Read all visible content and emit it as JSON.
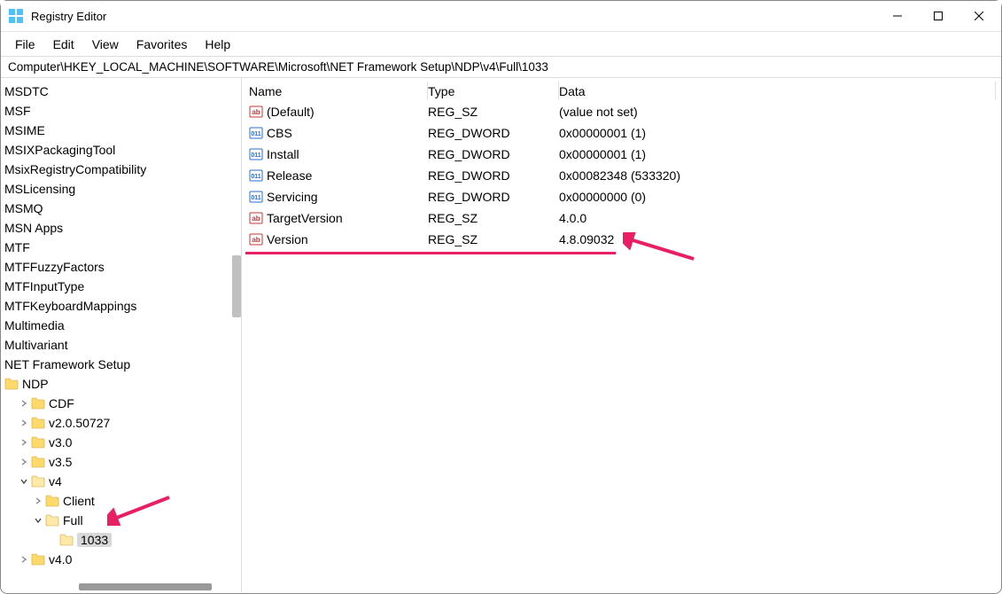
{
  "window": {
    "title": "Registry Editor"
  },
  "menu": [
    "File",
    "Edit",
    "View",
    "Favorites",
    "Help"
  ],
  "address": "Computer\\HKEY_LOCAL_MACHINE\\SOFTWARE\\Microsoft\\NET Framework Setup\\NDP\\v4\\Full\\1033",
  "tree": {
    "items": [
      {
        "label": "MSDTC",
        "lvl": 1
      },
      {
        "label": "MSF",
        "lvl": 1
      },
      {
        "label": "MSIME",
        "lvl": 1
      },
      {
        "label": "MSIXPackagingTool",
        "lvl": 1
      },
      {
        "label": "MsixRegistryCompatibility",
        "lvl": 1
      },
      {
        "label": "MSLicensing",
        "lvl": 1
      },
      {
        "label": "MSMQ",
        "lvl": 1
      },
      {
        "label": "MSN Apps",
        "lvl": 1
      },
      {
        "label": "MTF",
        "lvl": 1
      },
      {
        "label": "MTFFuzzyFactors",
        "lvl": 1
      },
      {
        "label": "MTFInputType",
        "lvl": 1
      },
      {
        "label": "MTFKeyboardMappings",
        "lvl": 1
      },
      {
        "label": "Multimedia",
        "lvl": 1
      },
      {
        "label": "Multivariant",
        "lvl": 1
      },
      {
        "label": "NET Framework Setup",
        "lvl": 1
      },
      {
        "label": "NDP",
        "lvl": 1,
        "folder": true
      },
      {
        "label": "CDF",
        "lvl": 2,
        "folder": true,
        "chev": "right"
      },
      {
        "label": "v2.0.50727",
        "lvl": 2,
        "folder": true,
        "chev": "right"
      },
      {
        "label": "v3.0",
        "lvl": 2,
        "folder": true,
        "chev": "right"
      },
      {
        "label": "v3.5",
        "lvl": 2,
        "folder": true,
        "chev": "right"
      },
      {
        "label": "v4",
        "lvl": 2,
        "folder": true,
        "chev": "down"
      },
      {
        "label": "Client",
        "lvl": 3,
        "folder": true,
        "chev": "right"
      },
      {
        "label": "Full",
        "lvl": 3,
        "folder": true,
        "chev": "down"
      },
      {
        "label": "1033",
        "lvl": 4,
        "folder": true,
        "selected": true
      },
      {
        "label": "v4.0",
        "lvl": 2,
        "folder": true,
        "chev": "right"
      }
    ]
  },
  "values": {
    "headers": {
      "name": "Name",
      "type": "Type",
      "data": "Data"
    },
    "rows": [
      {
        "icon": "sz",
        "name": "(Default)",
        "type": "REG_SZ",
        "data": "(value not set)"
      },
      {
        "icon": "dw",
        "name": "CBS",
        "type": "REG_DWORD",
        "data": "0x00000001 (1)"
      },
      {
        "icon": "dw",
        "name": "Install",
        "type": "REG_DWORD",
        "data": "0x00000001 (1)"
      },
      {
        "icon": "dw",
        "name": "Release",
        "type": "REG_DWORD",
        "data": "0x00082348 (533320)"
      },
      {
        "icon": "dw",
        "name": "Servicing",
        "type": "REG_DWORD",
        "data": "0x00000000 (0)"
      },
      {
        "icon": "sz",
        "name": "TargetVersion",
        "type": "REG_SZ",
        "data": "4.0.0"
      },
      {
        "icon": "sz",
        "name": "Version",
        "type": "REG_SZ",
        "data": "4.8.09032"
      }
    ]
  }
}
